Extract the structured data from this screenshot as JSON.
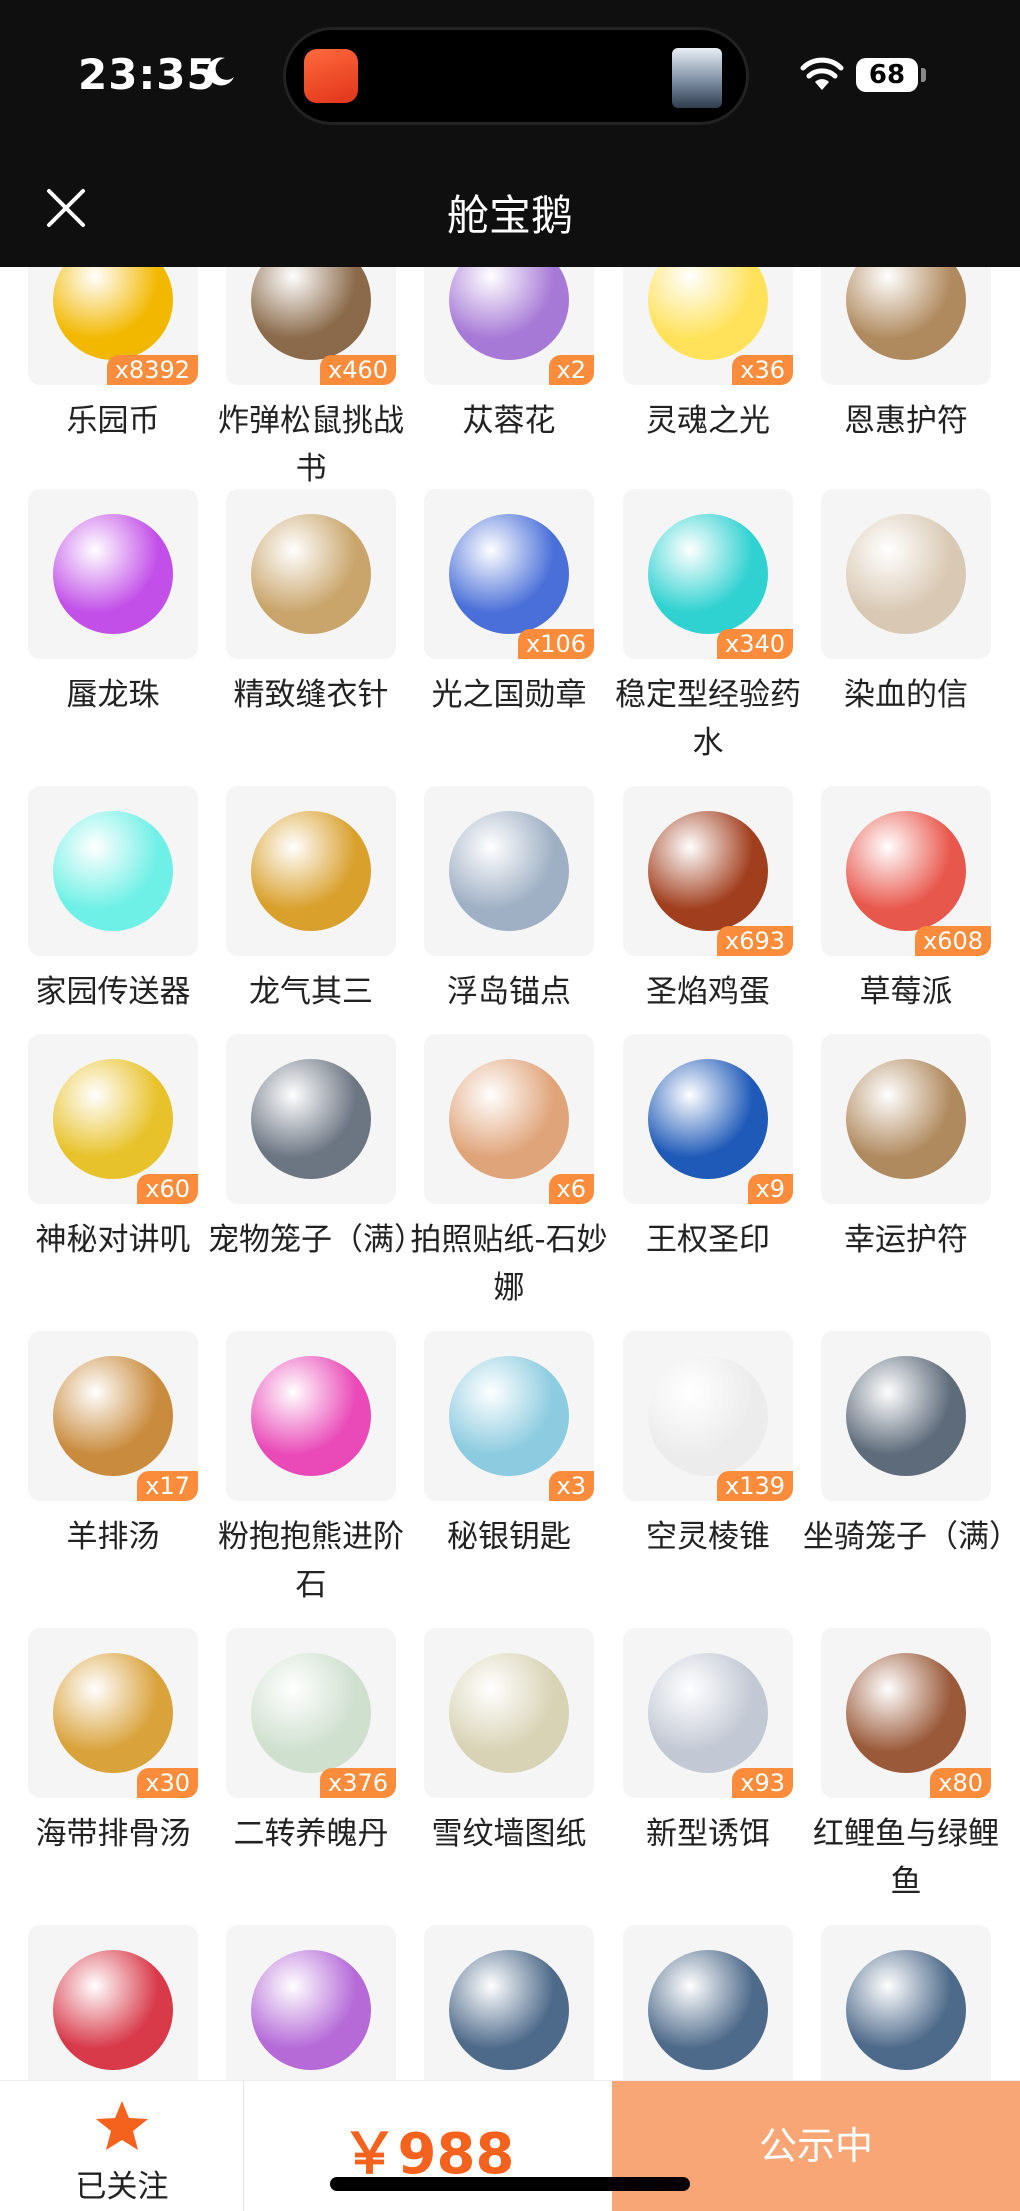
{
  "status_bar": {
    "time": "23:35",
    "battery": "68"
  },
  "nav": {
    "title": "舱宝鹅"
  },
  "colors": {
    "accent": "#f4621d",
    "badge": "#fb8c3b",
    "button_bg": "#f9a677"
  },
  "items": [
    {
      "name": "乐园币",
      "qty": "x8392",
      "icon_color": "#f2b800"
    },
    {
      "name": "炸弹松鼠挑战书",
      "qty": "x460",
      "icon_color": "#8a6a4a"
    },
    {
      "name": "苁蓉花",
      "qty": "x2",
      "icon_color": "#a679d6"
    },
    {
      "name": "灵魂之光",
      "qty": "x36",
      "icon_color": "#ffe25a"
    },
    {
      "name": "恩惠护符",
      "qty": "",
      "icon_color": "#b08a5f"
    },
    {
      "name": "蜃龙珠",
      "qty": "",
      "icon_color": "#c250e8"
    },
    {
      "name": "精致缝衣针",
      "qty": "",
      "icon_color": "#c9a56b"
    },
    {
      "name": "光之国勋章",
      "qty": "x106",
      "icon_color": "#4a6fd8"
    },
    {
      "name": "稳定型经验药水",
      "qty": "x340",
      "icon_color": "#2fd1d1"
    },
    {
      "name": "染血的信",
      "qty": "",
      "icon_color": "#d9c9b4"
    },
    {
      "name": "家园传送器",
      "qty": "",
      "icon_color": "#6ff0e6"
    },
    {
      "name": "龙气其三",
      "qty": "",
      "icon_color": "#d9a02c"
    },
    {
      "name": "浮岛锚点",
      "qty": "",
      "icon_color": "#9fb0c4"
    },
    {
      "name": "圣焰鸡蛋",
      "qty": "x693",
      "icon_color": "#a13e1d"
    },
    {
      "name": "草莓派",
      "qty": "x608",
      "icon_color": "#e8574c"
    },
    {
      "name": "神秘对讲叽",
      "qty": "x60",
      "icon_color": "#e8c22a"
    },
    {
      "name": "宠物笼子（满）",
      "qty": "",
      "icon_color": "#6c7683"
    },
    {
      "name": "拍照贴纸-石妙娜",
      "qty": "x6",
      "icon_color": "#e0a47a"
    },
    {
      "name": "王权圣印",
      "qty": "x9",
      "icon_color": "#1f5ab8"
    },
    {
      "name": "幸运护符",
      "qty": "",
      "icon_color": "#b08a5f"
    },
    {
      "name": "羊排汤",
      "qty": "x17",
      "icon_color": "#c98b3d"
    },
    {
      "name": "粉抱抱熊进阶石",
      "qty": "",
      "icon_color": "#e94ab8"
    },
    {
      "name": "秘银钥匙",
      "qty": "x3",
      "icon_color": "#8ccbe0"
    },
    {
      "name": "空灵棱锥",
      "qty": "x139",
      "icon_color": "#ececec"
    },
    {
      "name": "坐骑笼子（满）",
      "qty": "",
      "icon_color": "#5d6b7a"
    },
    {
      "name": "海带排骨汤",
      "qty": "x30",
      "icon_color": "#d9a23a"
    },
    {
      "name": "二转养魄丹",
      "qty": "x376",
      "icon_color": "#cfe0cf"
    },
    {
      "name": "雪纹墙图纸",
      "qty": "",
      "icon_color": "#d8d3b5"
    },
    {
      "name": "新型诱饵",
      "qty": "x93",
      "icon_color": "#c2c8d4"
    },
    {
      "name": "红鲤鱼与绿鲤鱼",
      "qty": "x80",
      "icon_color": "#9a5a3a"
    },
    {
      "name": "",
      "qty": "",
      "icon_color": "#d83a4a"
    },
    {
      "name": "",
      "qty": "",
      "icon_color": "#b56ad8"
    },
    {
      "name": "",
      "qty": "",
      "icon_color": "#4e6a8a"
    },
    {
      "name": "",
      "qty": "",
      "icon_color": "#4e6a8a"
    },
    {
      "name": "",
      "qty": "",
      "icon_color": "#4e6a8a"
    }
  ],
  "bottom": {
    "follow_label": "已关注",
    "price": "￥988",
    "button": "公示中"
  }
}
